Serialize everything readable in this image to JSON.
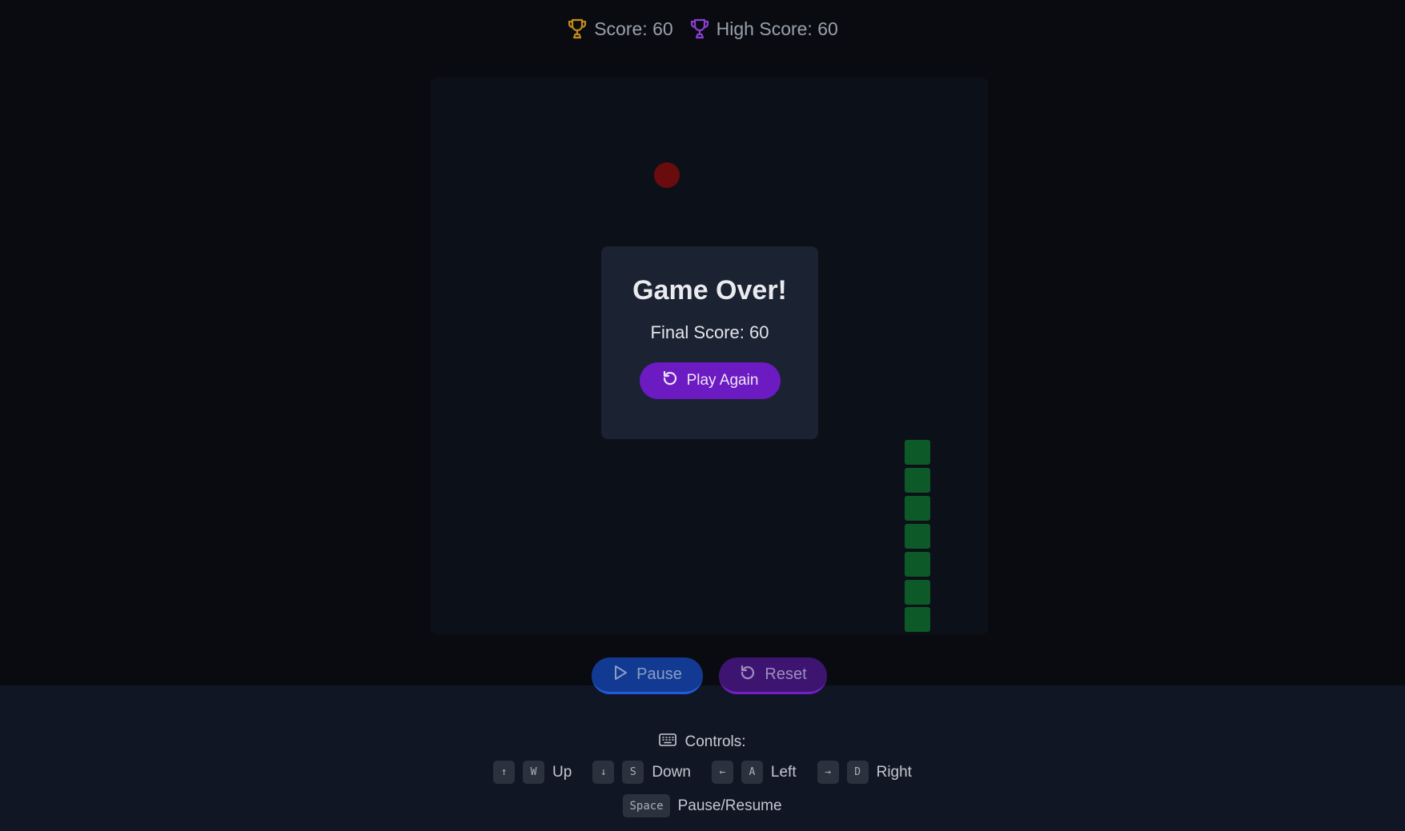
{
  "header": {
    "score_text": "Score: 60",
    "high_score_text": "High Score: 60",
    "score_icon": "trophy-icon",
    "high_score_icon": "trophy-icon",
    "score_icon_color": "#c38b16",
    "high_score_icon_color": "#8b3fd1"
  },
  "game": {
    "food_color": "#6a0b0e",
    "snake_color": "#0d5a28",
    "snake_length": 7
  },
  "game_over": {
    "title": "Game Over!",
    "final_score_text": "Final Score: 60",
    "play_again_label": "Play Again",
    "play_again_icon": "restart-icon"
  },
  "buttons": {
    "pause_label": "Pause",
    "pause_icon": "play-icon",
    "reset_label": "Reset",
    "reset_icon": "restart-icon"
  },
  "controls": {
    "title": "Controls:",
    "title_icon": "keyboard-icon",
    "mappings": [
      {
        "keys": [
          "↑",
          "W"
        ],
        "label": "Up"
      },
      {
        "keys": [
          "↓",
          "S"
        ],
        "label": "Down"
      },
      {
        "keys": [
          "←",
          "A"
        ],
        "label": "Left"
      },
      {
        "keys": [
          "→",
          "D"
        ],
        "label": "Right"
      }
    ],
    "space": {
      "key": "Space",
      "label": "Pause/Resume"
    }
  },
  "colors": {
    "background": "#090b11",
    "board": "#0c1119",
    "modal": "#1b2231",
    "play_again": "#6c1ac2",
    "pause": "#123a93",
    "reset": "#3d1570"
  }
}
